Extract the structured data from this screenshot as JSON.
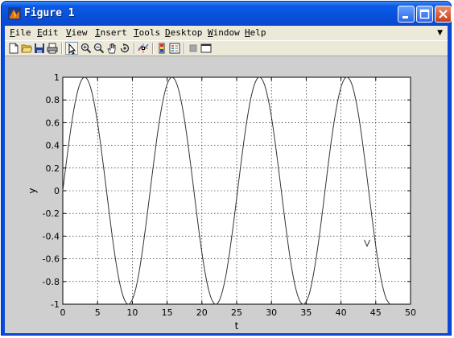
{
  "window": {
    "title": "Figure 1",
    "title_bar_color": "#0752dc",
    "figure_background": "#cfcfcf"
  },
  "menubar": {
    "items": [
      {
        "label": "File",
        "underline": "F",
        "rest": "ile"
      },
      {
        "label": "Edit",
        "underline": "E",
        "rest": "dit"
      },
      {
        "label": "View",
        "underline": "V",
        "rest": "iew"
      },
      {
        "label": "Insert",
        "underline": "I",
        "rest": "nsert"
      },
      {
        "label": "Tools",
        "underline": "T",
        "rest": "ools"
      },
      {
        "label": "Desktop",
        "underline": "D",
        "rest": "esktop"
      },
      {
        "label": "Window",
        "underline": "W",
        "rest": "indow"
      },
      {
        "label": "Help",
        "underline": "H",
        "rest": "elp"
      }
    ]
  },
  "toolbar": {
    "icons": [
      "new-file-icon",
      "open-file-icon",
      "save-icon",
      "print-icon",
      "edit-plot-arrow-icon",
      "zoom-in-icon",
      "zoom-out-icon",
      "pan-hand-icon",
      "rotate-3d-icon",
      "data-cursor-icon",
      "insert-colorbar-icon",
      "insert-legend-icon",
      "hide-plot-tools-icon",
      "show-plot-tools-icon"
    ]
  },
  "chart_data": {
    "type": "line",
    "function": "y = sin(0.5*t)",
    "x": [
      0,
      0.5,
      1,
      1.5,
      2,
      2.5,
      3,
      3.5,
      4,
      4.5,
      5,
      5.5,
      6,
      6.5,
      7,
      7.5,
      8,
      8.5,
      9,
      9.5,
      10,
      10.5,
      11,
      11.5,
      12,
      12.5,
      13,
      13.5,
      14,
      14.5,
      15,
      15.5,
      16,
      16.5,
      17,
      17.5,
      18,
      18.5,
      19,
      19.5,
      20,
      20.5,
      21,
      21.5,
      22,
      22.5,
      23,
      23.5,
      24,
      24.5,
      25,
      25.5,
      26,
      26.5,
      27,
      27.5,
      28,
      28.5,
      29,
      29.5,
      30,
      30.5,
      31,
      31.5,
      32,
      32.5,
      33,
      33.5,
      34,
      34.5,
      35,
      35.5,
      36,
      36.5,
      37,
      37.5,
      38,
      38.5,
      39,
      39.5,
      40,
      40.5,
      41,
      41.5,
      42,
      42.5,
      43,
      43.5,
      44,
      44.5,
      45,
      45.5,
      46,
      46.5,
      47
    ],
    "y": [
      0,
      0.247,
      0.479,
      0.682,
      0.841,
      0.949,
      0.997,
      0.984,
      0.909,
      0.778,
      0.598,
      0.382,
      0.141,
      -0.108,
      -0.351,
      -0.572,
      -0.757,
      -0.895,
      -0.977,
      -0.999,
      -0.959,
      -0.862,
      -0.706,
      -0.508,
      -0.279,
      -0.033,
      0.215,
      0.45,
      0.657,
      0.823,
      0.938,
      0.994,
      0.989,
      0.922,
      0.798,
      0.624,
      0.412,
      0.174,
      -0.075,
      -0.32,
      -0.544,
      -0.735,
      -0.88,
      -0.97,
      -1.0,
      -0.968,
      -0.875,
      -0.731,
      -0.537,
      -0.312,
      -0.066,
      0.182,
      0.42,
      0.63,
      0.804,
      0.925,
      0.991,
      0.993,
      0.935,
      0.817,
      0.65,
      0.441,
      0.206,
      -0.042,
      -0.288,
      -0.516,
      -0.712,
      -0.863,
      -0.961,
      -0.999,
      -0.978,
      -0.896,
      -0.751,
      -0.566,
      -0.347,
      -0.103,
      0.149,
      0.391,
      0.602,
      0.78,
      0.913,
      0.985,
      0.997,
      0.949,
      0.838,
      0.676,
      0.47,
      0.238,
      -0.009,
      -0.256,
      -0.488,
      -0.689,
      -0.846,
      -0.951,
      -0.998,
      -0.984,
      -0.907
    ],
    "xlabel": "t",
    "ylabel": "y",
    "xlim": [
      0,
      50
    ],
    "ylim": [
      -1,
      1
    ],
    "xticks": [
      "0",
      "5",
      "10",
      "15",
      "20",
      "25",
      "30",
      "35",
      "40",
      "45",
      "50"
    ],
    "yticks": [
      "1",
      "0.8",
      "0.6",
      "0.4",
      "0.2",
      "0",
      "-0.2",
      "-0.4",
      "-0.6",
      "-0.8",
      "-1"
    ],
    "grid": true,
    "line_color": "#333333"
  }
}
